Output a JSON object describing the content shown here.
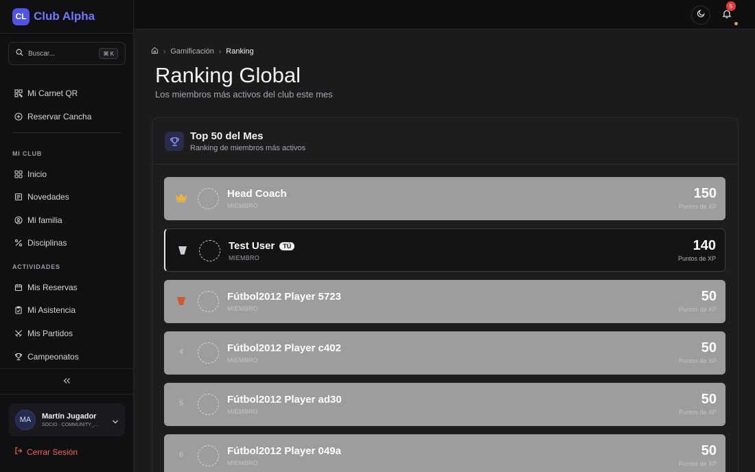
{
  "brand": {
    "logo_text": "CL",
    "name": "Club Alpha"
  },
  "search": {
    "placeholder": "Buscar...",
    "shortcut": "⌘ K"
  },
  "quick_links": [
    {
      "label": "Mi Carnet QR",
      "icon": "qr-icon"
    },
    {
      "label": "Reservar Cancha",
      "icon": "plus-circle-icon"
    }
  ],
  "sections": {
    "mi_club": {
      "title": "MI CLUB",
      "items": [
        {
          "label": "Inicio",
          "icon": "grid-icon"
        },
        {
          "label": "Novedades",
          "icon": "newspaper-icon"
        },
        {
          "label": "Mi familia",
          "icon": "family-icon"
        },
        {
          "label": "Disciplinas",
          "icon": "disciplines-icon"
        }
      ]
    },
    "actividades": {
      "title": "ACTIVIDADES",
      "items": [
        {
          "label": "Mis Reservas",
          "icon": "calendar-icon"
        },
        {
          "label": "Mi Asistencia",
          "icon": "clipboard-icon"
        },
        {
          "label": "Mis Partidos",
          "icon": "swords-icon"
        },
        {
          "label": "Campeonatos",
          "icon": "trophy-icon"
        }
      ]
    }
  },
  "user": {
    "initials": "MA",
    "name": "Martín Jugador",
    "role": "SOCIO · COMMUNITY_..."
  },
  "logout_label": "Cerrar Sesión",
  "topbar": {
    "notifications_count": "5"
  },
  "breadcrumb": {
    "items": [
      "Gamificación",
      "Ranking"
    ]
  },
  "page": {
    "title": "Ranking Global",
    "subtitle": "Los miembros más activos del club este mes"
  },
  "card": {
    "title": "Top 50 del Mes",
    "subtitle": "Ranking de miembros más activos"
  },
  "ranking": [
    {
      "rank": "1",
      "name": "Head Coach",
      "role": "MIEMBRO",
      "points": "150",
      "points_label": "Puntos de XP",
      "medal": "gold-crown-icon"
    },
    {
      "rank": "2",
      "name": "Test User",
      "role": "MIEMBRO",
      "points": "140",
      "points_label": "Puntos de XP",
      "medal": "silver-medal-icon",
      "badge": "TÚ"
    },
    {
      "rank": "3",
      "name": "Fútbol2012 Player 5723",
      "role": "MIEMBRO",
      "points": "50",
      "points_label": "Puntos de XP",
      "medal": "bronze-medal-icon"
    },
    {
      "rank": "4",
      "name": "Fútbol2012 Player c402",
      "role": "MIEMBRO",
      "points": "50",
      "points_label": "Puntos de XP"
    },
    {
      "rank": "5",
      "name": "Fútbol2012 Player ad30",
      "role": "MIEMBRO",
      "points": "50",
      "points_label": "Puntos de XP"
    },
    {
      "rank": "6",
      "name": "Fútbol2012 Player 049a",
      "role": "MIEMBRO",
      "points": "50",
      "points_label": "Puntos de XP"
    }
  ],
  "colors": {
    "accent": "#4f54e6",
    "brand_text": "#6f78ff",
    "logout": "#f2634f",
    "badge_red": "#e33a3a",
    "gold": "#e8b53a",
    "silver": "#cfcfd3",
    "bronze": "#d2592c"
  }
}
